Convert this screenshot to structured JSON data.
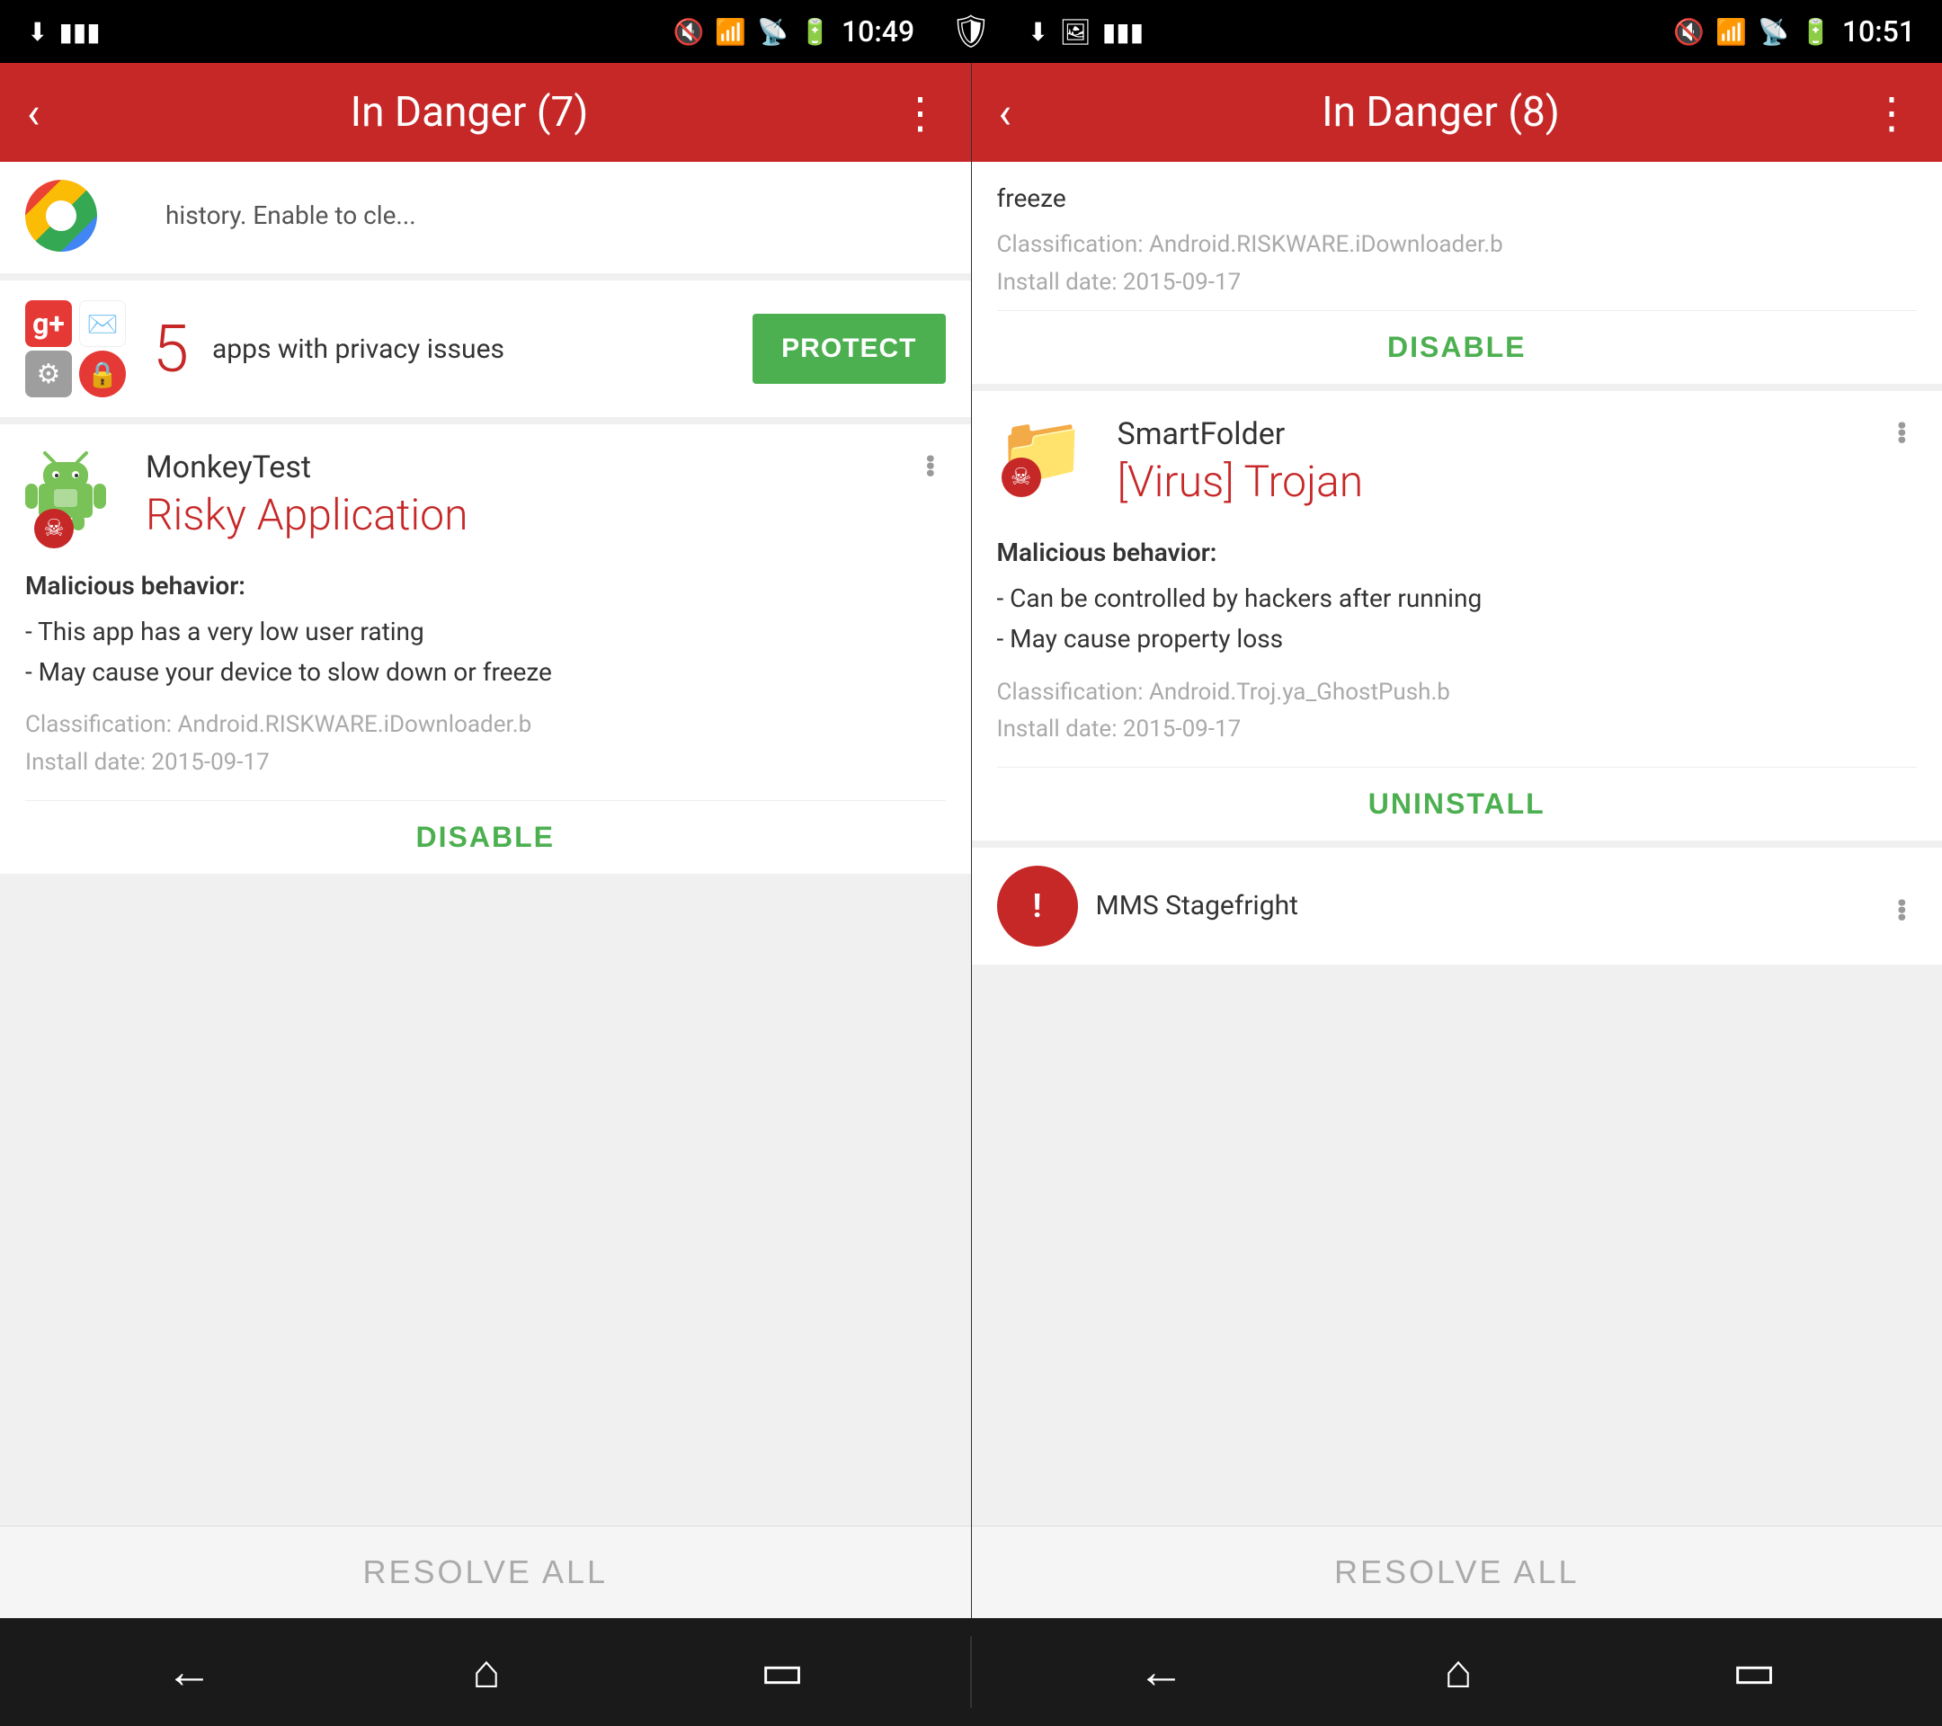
{
  "screens": {
    "left": {
      "status_bar": {
        "time": "10:49",
        "icons": [
          "download-icon",
          "bars-icon",
          "mute-icon",
          "wifi-icon",
          "signal-icon",
          "battery-icon"
        ]
      },
      "header": {
        "title": "In Danger (7)",
        "back_label": "‹",
        "menu_label": "⋮"
      },
      "partial_top": {
        "text": "history. Enable to cle..."
      },
      "privacy_card": {
        "count": "5",
        "label": "apps with privacy issues",
        "protect_label": "PROTECT"
      },
      "threat_card": {
        "app_name": "MonkeyTest",
        "threat_type": "Risky Application",
        "behavior_title": "Malicious behavior:",
        "behaviors": [
          "- This app has a very low user rating",
          "- May cause your device to slow down or freeze"
        ],
        "classification": "Classification: Android.RISKWARE.iDownloader.b",
        "install_date": "Install date: 2015-09-17",
        "action_label": "DISABLE"
      },
      "resolve_all": {
        "label": "RESOLVE ALL"
      }
    },
    "right": {
      "status_bar": {
        "time": "10:51",
        "icons": [
          "mute-icon",
          "wifi-icon",
          "signal-icon",
          "battery-icon"
        ]
      },
      "header": {
        "title": "In Danger (8)",
        "back_label": "‹",
        "menu_label": "⋮"
      },
      "partial_top": {
        "continuation": "freeze",
        "classification": "Classification: Android.RISKWARE.iDownloader.b",
        "install_date": "Install date: 2015-09-17",
        "action_label": "DISABLE"
      },
      "threat_card": {
        "app_name": "SmartFolder",
        "threat_type": "[Virus] Trojan",
        "behavior_title": "Malicious behavior:",
        "behaviors": [
          "- Can be controlled by hackers after running",
          "- May cause property loss"
        ],
        "classification": "Classification: Android.Troj.ya_GhostPush.b",
        "install_date": "Install date: 2015-09-17",
        "action_label": "UNINSTALL"
      },
      "partial_bottom": {
        "app_name": "MMS Stagefright"
      },
      "resolve_all": {
        "label": "RESOLVE ALL"
      }
    }
  },
  "nav": {
    "back_label": "←",
    "home_label": "⌂",
    "recent_label": "▭"
  }
}
